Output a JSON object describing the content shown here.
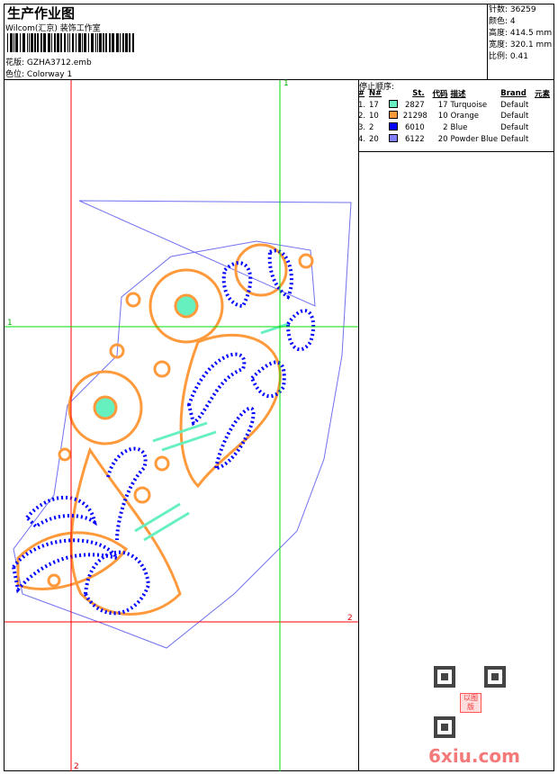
{
  "header": {
    "title": "生产作业图",
    "company": "Wilcom(汇京) 装饰工作室",
    "design_label": "花版:",
    "design_value": "GZHA3712.emb",
    "colorway_label": "色位:",
    "colorway_value": "Colorway 1"
  },
  "info": [
    {
      "label": "针数:",
      "value": "36259"
    },
    {
      "label": "颜色:",
      "value": "4"
    },
    {
      "label": "高度:",
      "value": "414.5 mm"
    },
    {
      "label": "宽度:",
      "value": "320.1 mm"
    },
    {
      "label": "比例:",
      "value": "0.41"
    }
  ],
  "stop_sequence": {
    "title": "停止顺序:",
    "columns": [
      "#",
      "N#",
      "St.",
      "代码",
      "描述",
      "Brand",
      "元素"
    ],
    "rows": [
      {
        "idx": "1.",
        "n": "17",
        "color": "#66f0c0",
        "st": "2827",
        "code": "17",
        "desc": "Turquoise",
        "brand": "Default"
      },
      {
        "idx": "2.",
        "n": "10",
        "color": "#ff9a3c",
        "st": "21298",
        "code": "10",
        "desc": "Orange",
        "brand": "Default"
      },
      {
        "idx": "3.",
        "n": "2",
        "color": "#0000ff",
        "st": "6010",
        "code": "2",
        "desc": "Blue",
        "brand": "Default"
      },
      {
        "idx": "4.",
        "n": "20",
        "color": "#8080ff",
        "st": "6122",
        "code": "20",
        "desc": "Powder Blue",
        "brand": "Default"
      }
    ]
  },
  "guides": {
    "green_label": "1",
    "red_label": "2",
    "green_color": "#00e000",
    "red_color": "#ff0000"
  },
  "watermark": {
    "text": "6xiu.com",
    "stamp": "以图版"
  }
}
